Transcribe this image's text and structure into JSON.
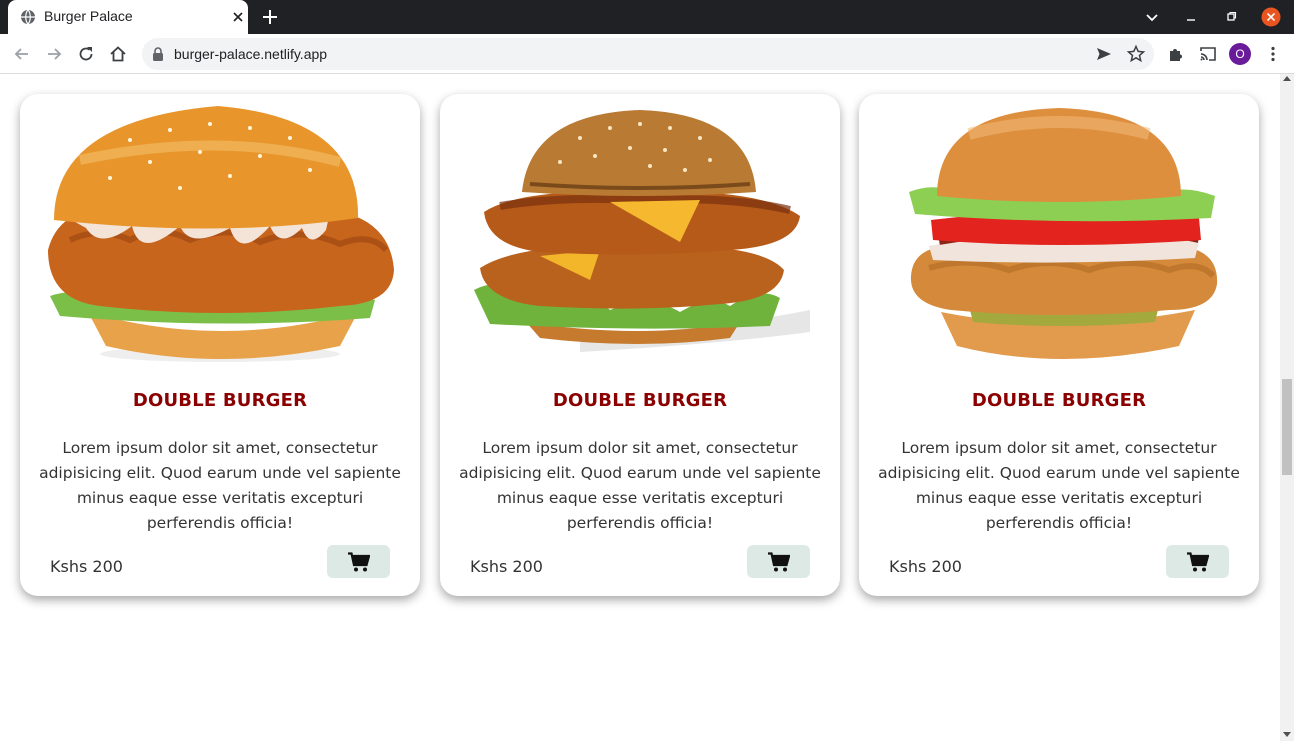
{
  "browser": {
    "tab_title": "Burger Palace",
    "url": "burger-palace.netlify.app",
    "profile_initial": "O"
  },
  "colors": {
    "title_red": "#8b0000",
    "cart_button_bg": "#dde9e5",
    "chrome_dark": "#202124",
    "close_button": "#e95420"
  },
  "products": [
    {
      "name": "DOUBLE BURGER",
      "description": "Lorem ipsum dolor sit amet, consectetur adipisicing elit. Quod earum unde vel sapiente minus eaque esse veritatis excepturi perferendis officia!",
      "price": "Kshs 200",
      "cart_icon": "cart-icon"
    },
    {
      "name": "DOUBLE BURGER",
      "description": "Lorem ipsum dolor sit amet, consectetur adipisicing elit. Quod earum unde vel sapiente minus eaque esse veritatis excepturi perferendis officia!",
      "price": "Kshs 200",
      "cart_icon": "cart-icon"
    },
    {
      "name": "DOUBLE BURGER",
      "description": "Lorem ipsum dolor sit amet, consectetur adipisicing elit. Quod earum unde vel sapiente minus eaque esse veritatis excepturi perferendis officia!",
      "price": "Kshs 200",
      "cart_icon": "cart-icon"
    }
  ]
}
